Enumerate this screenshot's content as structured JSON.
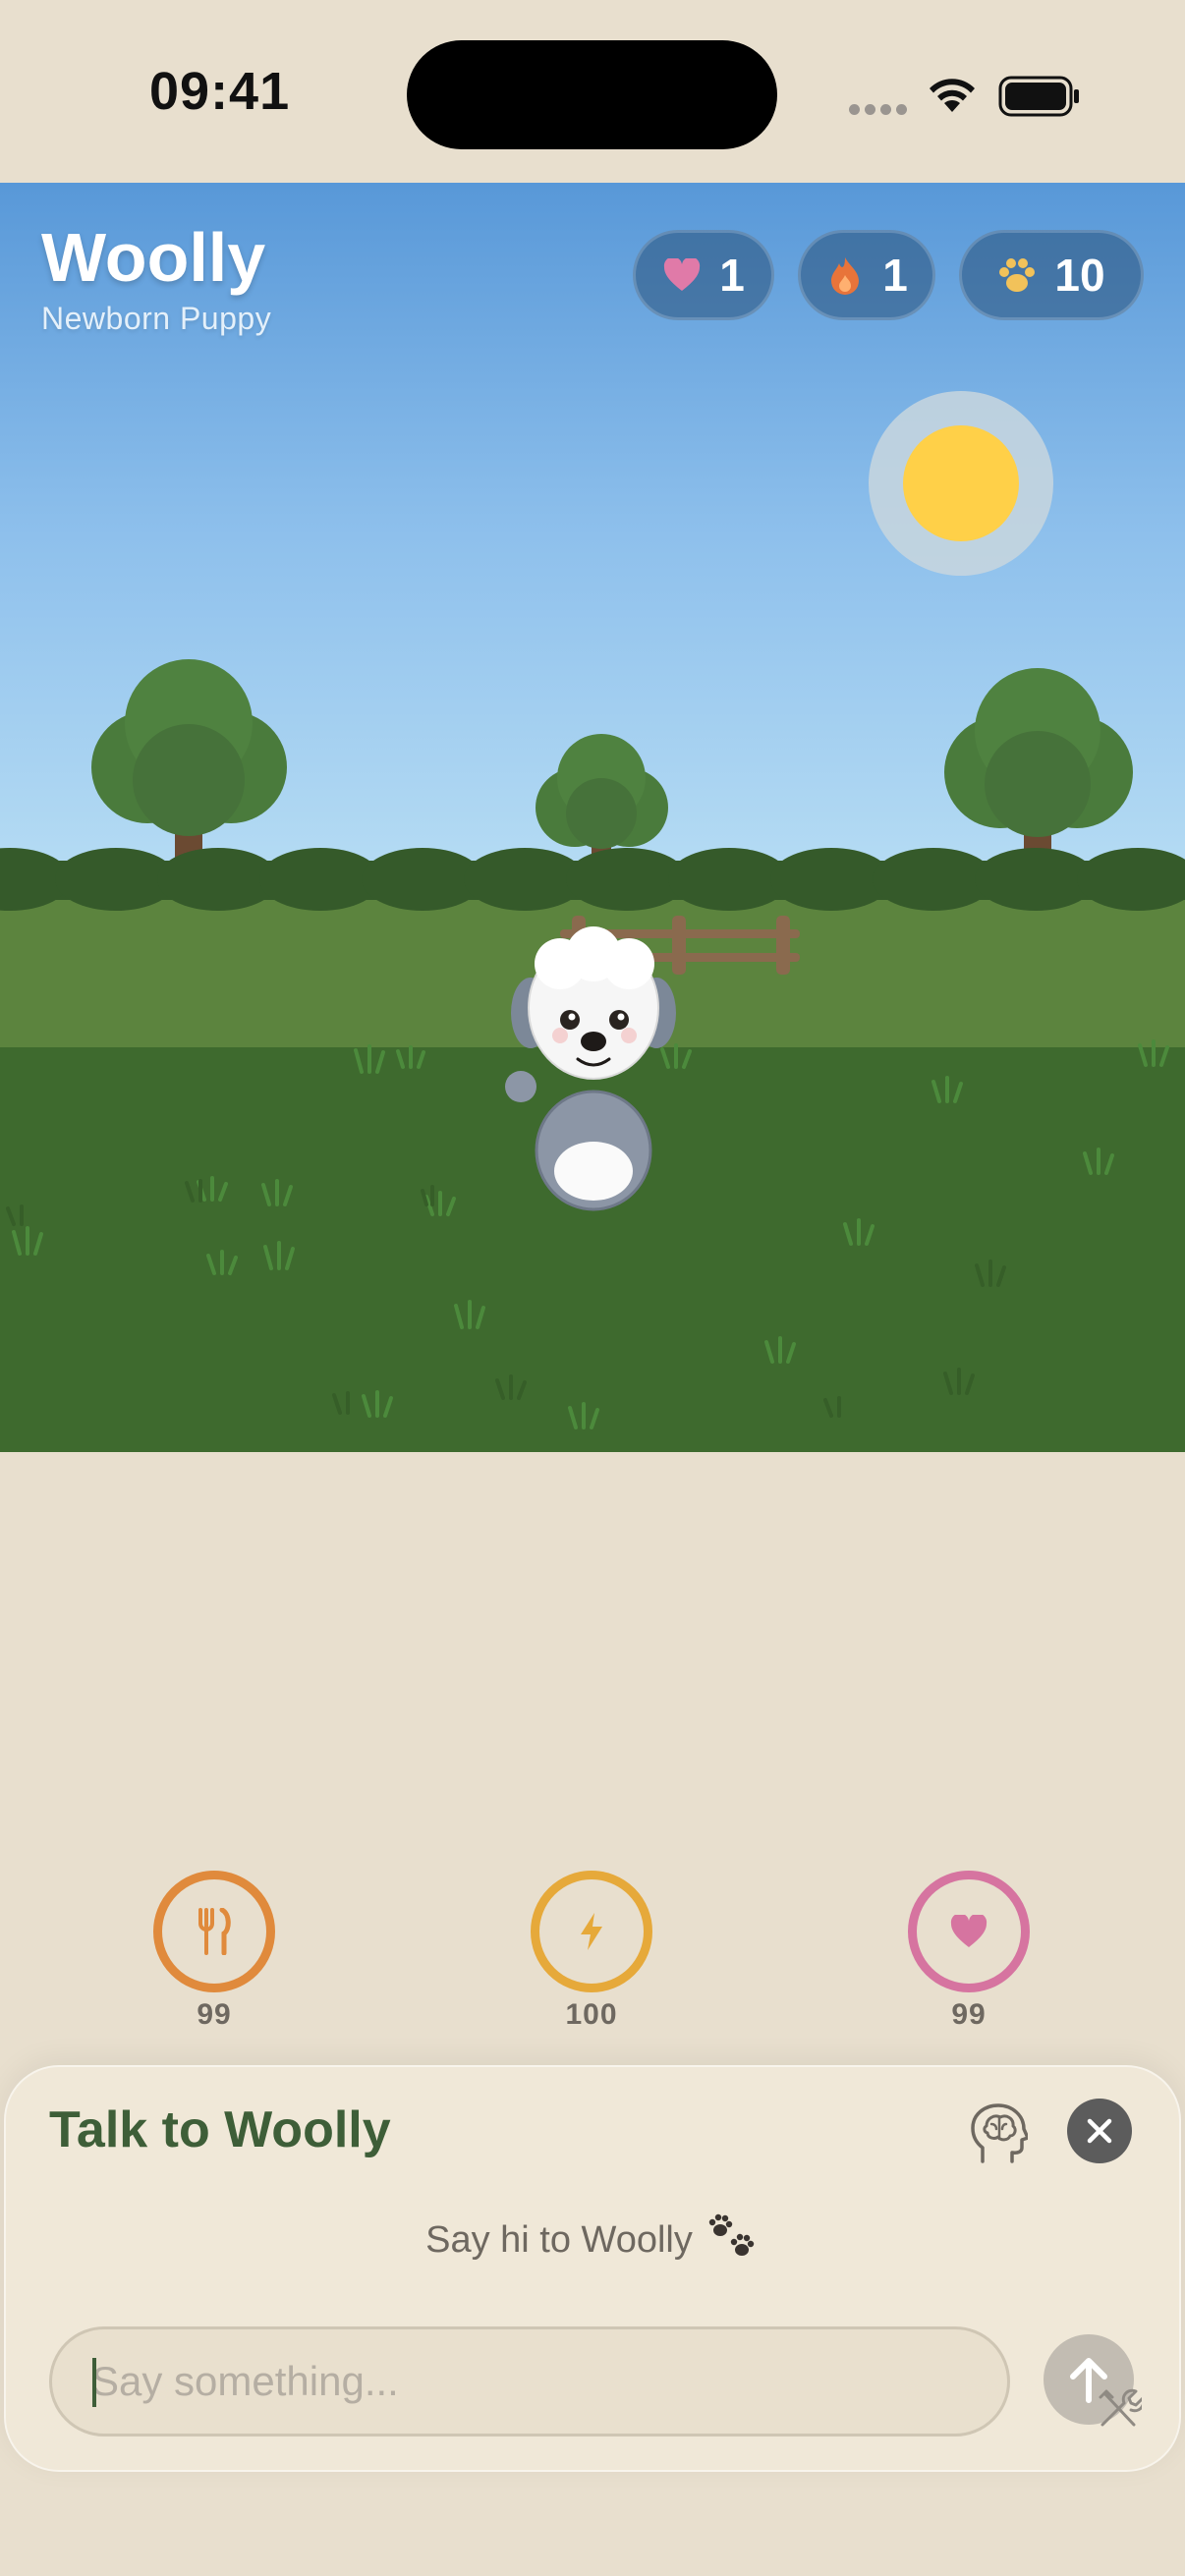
{
  "status_bar": {
    "time": "09:41"
  },
  "header": {
    "pet_name": "Woolly",
    "stage": "Newborn Puppy"
  },
  "badges": [
    {
      "icon": "heart-icon",
      "value": "1",
      "color": "#E07AA8"
    },
    {
      "icon": "flame-icon",
      "value": "1",
      "color": "#E8743A"
    },
    {
      "icon": "paw-icon",
      "value": "10",
      "color": "#F2C25A"
    }
  ],
  "stats": [
    {
      "icon": "fork-knife-icon",
      "value": "99",
      "color": "#E08A3C"
    },
    {
      "icon": "bolt-icon",
      "value": "100",
      "color": "#E6A93A"
    },
    {
      "icon": "heart-icon",
      "value": "99",
      "color": "#D674A0"
    }
  ],
  "chat": {
    "title": "Talk to Woolly",
    "hint": "Say hi to Woolly",
    "placeholder": "Say something..."
  },
  "colors": {
    "accent_green": "#3E5E38",
    "background": "#E8DFCE",
    "sky_top": "#5A9AD8",
    "grass": "#3E6A2E"
  }
}
